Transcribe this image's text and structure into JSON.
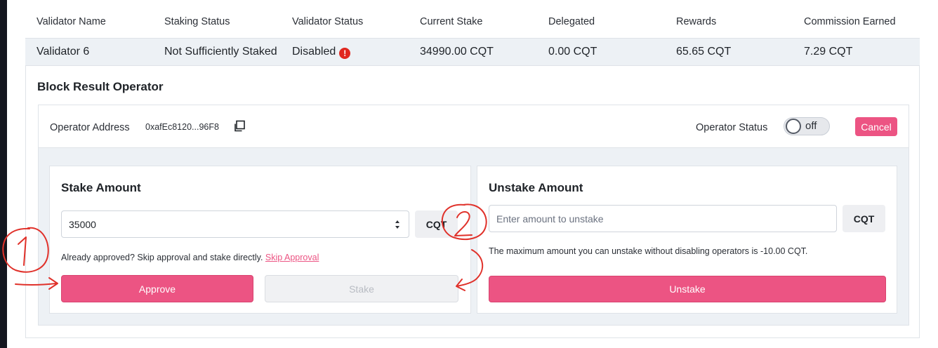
{
  "table": {
    "headers": [
      "Validator Name",
      "Staking Status",
      "Validator Status",
      "Current Stake",
      "Delegated",
      "Rewards",
      "Commission Earned"
    ],
    "row": {
      "name": "Validator 6",
      "staking_status": "Not Sufficiently Staked",
      "validator_status": "Disabled",
      "current_stake": "34990.00 CQT",
      "delegated": "0.00 CQT",
      "rewards": "65.65 CQT",
      "commission_earned": "7.29 CQT"
    }
  },
  "operator_section": {
    "title": "Block Result Operator",
    "address_label": "Operator Address",
    "address_value": "0xafEc8120...96F8",
    "status_label": "Operator Status",
    "toggle_label": "off",
    "cancel_label": "Cancel"
  },
  "stake": {
    "title": "Stake Amount",
    "input_value": "35000",
    "unit": "CQT",
    "helper_text": "Already approved? Skip approval and stake directly.",
    "skip_link": "Skip Approval",
    "approve_label": "Approve",
    "stake_label": "Stake"
  },
  "unstake": {
    "title": "Unstake Amount",
    "placeholder": "Enter amount to unstake",
    "unit": "CQT",
    "helper_text": "The maximum amount you can unstake without disabling operators is -10.00 CQT.",
    "unstake_label": "Unstake"
  },
  "annotations": {
    "marker_1": "1",
    "marker_2": "2",
    "color": "#e0312a"
  },
  "colors": {
    "accent": "#ec5483",
    "warning": "#e0271f",
    "panel_bg": "#edf1f5"
  }
}
